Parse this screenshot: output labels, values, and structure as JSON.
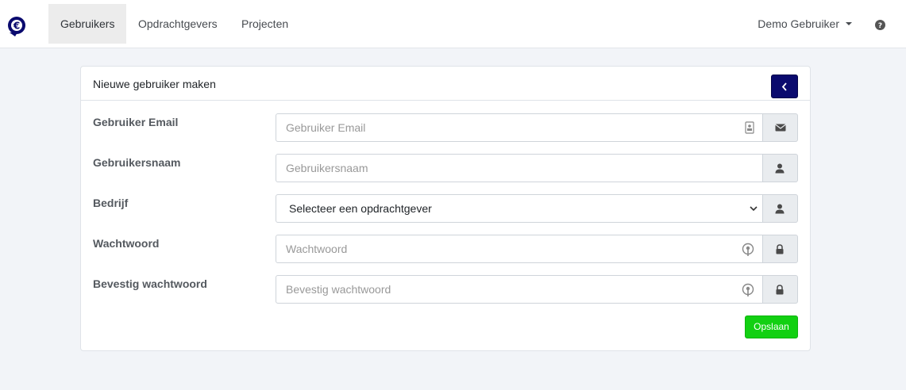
{
  "nav": {
    "items": [
      {
        "label": "Gebruikers",
        "active": true
      },
      {
        "label": "Opdrachtgevers"
      },
      {
        "label": "Projecten"
      }
    ],
    "user_label": "Demo Gebruiker",
    "logo_icon": "euro-coin-logo",
    "help_icon": "question-circle-icon"
  },
  "card": {
    "title": "Nieuwe gebruiker maken",
    "back_icon": "chevron-left-icon",
    "fields": [
      {
        "label": "Gebruiker Email",
        "placeholder": "Gebruiker Email",
        "icon": "envelope-icon"
      },
      {
        "label": "Gebruikersnaam",
        "placeholder": "Gebruikersnaam",
        "icon": "user-icon"
      },
      {
        "label": "Bedrijf",
        "value": "Selecteer een opdrachtgever",
        "icon": "user-icon"
      },
      {
        "label": "Wachtwoord",
        "placeholder": "Wachtwoord",
        "icon": "lock-icon"
      },
      {
        "label": "Bevestig wachtwoord",
        "placeholder": "Bevestig wachtwoord",
        "icon": "lock-icon"
      }
    ],
    "save_label": "Opslaan"
  },
  "colors": {
    "brand": "#0a0a6e",
    "save": "#12d012",
    "background": "#f2f4f8"
  }
}
